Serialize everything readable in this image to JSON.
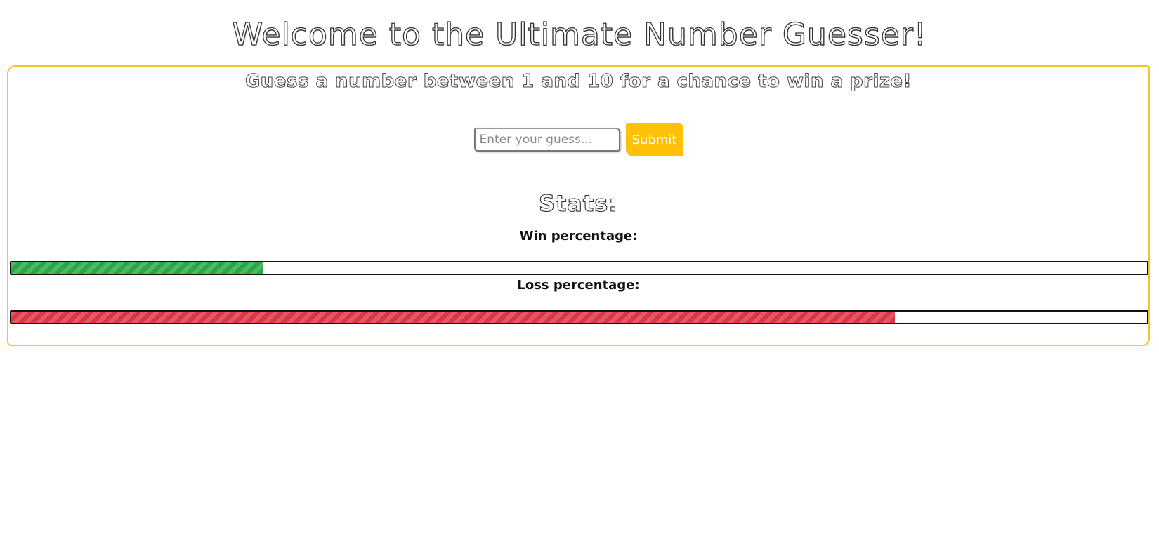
{
  "header": {
    "title": "Welcome to the Ultimate Number Guesser!"
  },
  "game": {
    "subtitle": "Guess a number between 1 and 10 for a chance to win a prize!",
    "input_placeholder": "Enter your guess...",
    "input_value": "",
    "submit_label": "Submit"
  },
  "stats": {
    "heading": "Stats:",
    "win_label": "Win percentage:",
    "loss_label": "Loss percentage:",
    "win_percent": 22.2,
    "loss_percent": 77.8
  },
  "colors": {
    "accent": "#ffc107",
    "win": "#28a745",
    "loss": "#dc3545",
    "card_border": "#f5c42c"
  }
}
